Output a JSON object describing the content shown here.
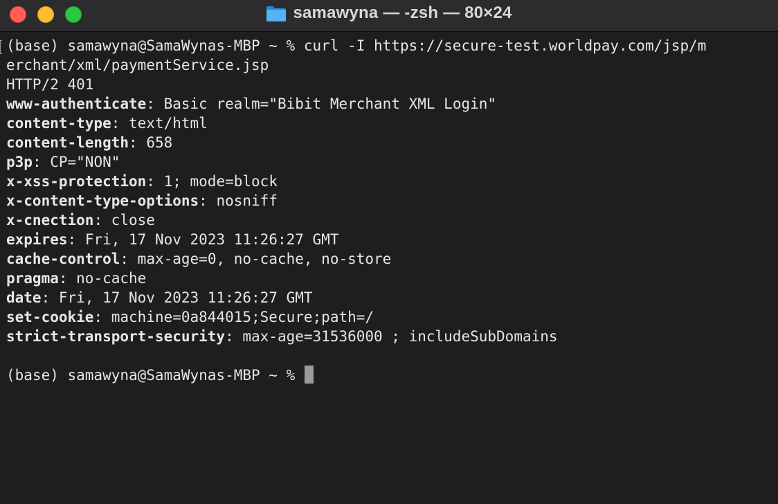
{
  "window": {
    "title": "samawyna — -zsh — 80×24",
    "folder_icon": "folder-icon",
    "colors": {
      "close": "#ff5f57",
      "minimize": "#febc2e",
      "zoom": "#28c840",
      "background": "#1e1e1e",
      "titlebar": "#2c2c2e",
      "text": "#e6e6e6",
      "cursor": "#9b9b9b"
    }
  },
  "terminal": {
    "command_line_1": "(base) samawyna@SamaWynas-MBP ~ % curl -I https://secure-test.worldpay.com/jsp/m",
    "command_line_2": "erchant/xml/paymentService.jsp",
    "status": "HTTP/2 401",
    "headers": [
      {
        "key": "www-authenticate",
        "value": " Basic realm=\"Bibit Merchant XML Login\""
      },
      {
        "key": "content-type",
        "value": " text/html"
      },
      {
        "key": "content-length",
        "value": " 658"
      },
      {
        "key": "p3p",
        "value": " CP=\"NON\""
      },
      {
        "key": "x-xss-protection",
        "value": " 1; mode=block"
      },
      {
        "key": "x-content-type-options",
        "value": " nosniff"
      },
      {
        "key": "x-cnection",
        "value": " close"
      },
      {
        "key": "expires",
        "value": " Fri, 17 Nov 2023 11:26:27 GMT"
      },
      {
        "key": "cache-control",
        "value": " max-age=0, no-cache, no-store"
      },
      {
        "key": "pragma",
        "value": " no-cache"
      },
      {
        "key": "date",
        "value": " Fri, 17 Nov 2023 11:26:27 GMT"
      },
      {
        "key": "set-cookie",
        "value": " machine=0a844015;Secure;path=/"
      },
      {
        "key": "strict-transport-security",
        "value": " max-age=31536000 ; includeSubDomains"
      }
    ],
    "prompt": "(base) samawyna@SamaWynas-MBP ~ % "
  }
}
